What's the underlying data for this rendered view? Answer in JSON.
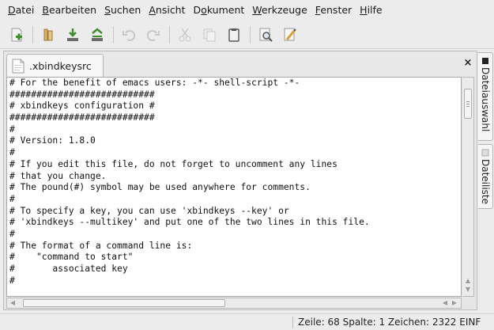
{
  "menubar": {
    "items": [
      {
        "label": "Datei"
      },
      {
        "label": "Bearbeiten"
      },
      {
        "label": "Suchen"
      },
      {
        "label": "Ansicht"
      },
      {
        "label": "Dokument"
      },
      {
        "label": "Werkzeuge"
      },
      {
        "label": "Fenster"
      },
      {
        "label": "Hilfe"
      }
    ]
  },
  "toolbar": {
    "icons": [
      "new-file-icon",
      "open-file-icon",
      "save-icon",
      "save-as-icon",
      "undo-icon",
      "redo-icon",
      "cut-icon",
      "copy-icon",
      "paste-icon",
      "find-icon",
      "replace-icon"
    ]
  },
  "editor": {
    "tab_label": ".xbindkeysrc",
    "tab_close": "×",
    "lines": [
      "# For the benefit of emacs users: -*- shell-script -*-",
      "###########################",
      "# xbindkeys configuration #",
      "###########################",
      "#",
      "# Version: 1.8.0",
      "#",
      "# If you edit this file, do not forget to uncomment any lines",
      "# that you change.",
      "# The pound(#) symbol may be used anywhere for comments.",
      "#",
      "# To specify a key, you can use 'xbindkeys --key' or",
      "# 'xbindkeys --multikey' and put one of the two lines in this file.",
      "#",
      "# The format of a command line is:",
      "#    \"command to start\"",
      "#       associated key",
      "#"
    ]
  },
  "sidepanel": {
    "tabs": [
      {
        "label": "Dateiauswahl"
      },
      {
        "label": "Dateiliste"
      }
    ]
  },
  "statusbar": {
    "text": "Zeile: 68 Spalte: 1  Zeichen: 2322  EINF"
  },
  "colors": {
    "background": "#ececec",
    "editor_background": "#ffffff",
    "save_green": "#3e8e2a"
  }
}
